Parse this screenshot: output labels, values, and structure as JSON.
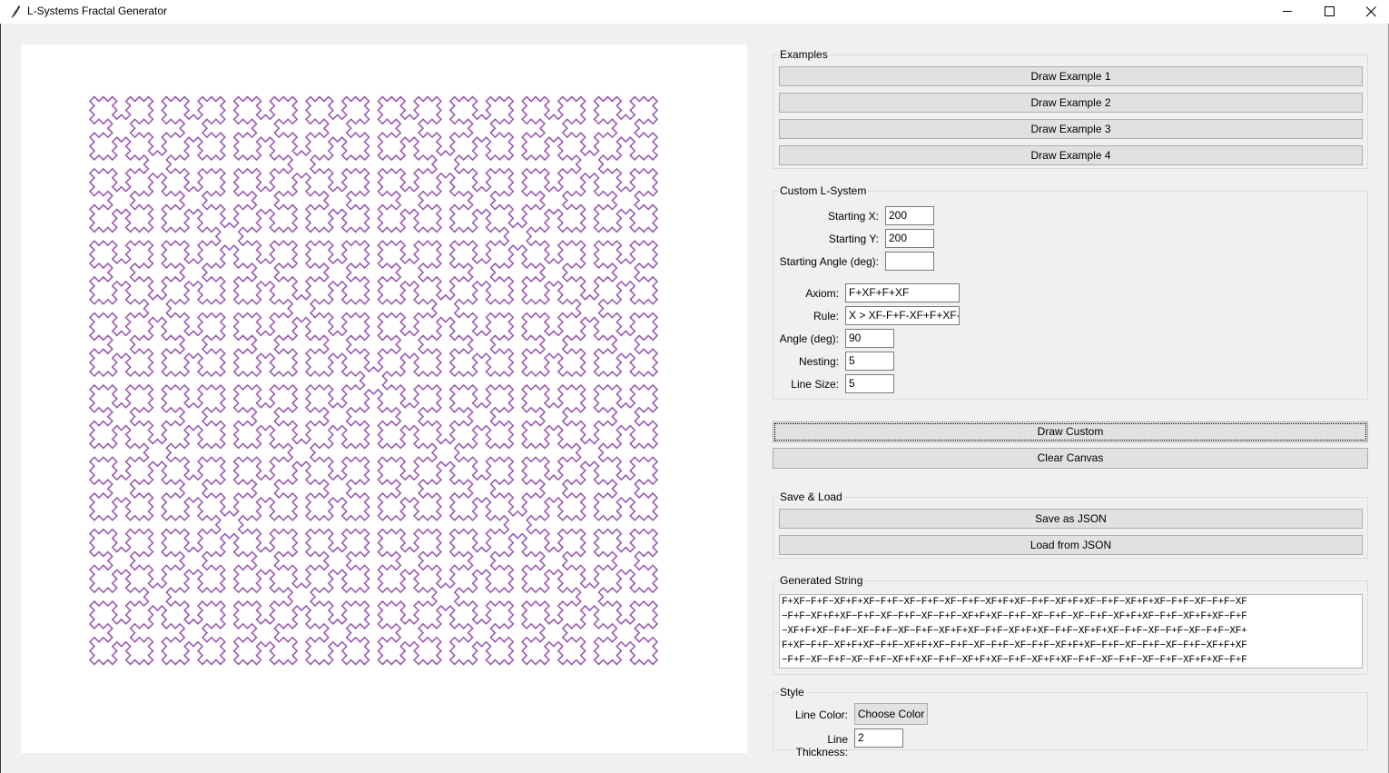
{
  "window": {
    "title": "L-Systems Fractal Generator",
    "controls": {
      "minimize": "minimize-icon",
      "maximize": "maximize-icon",
      "close": "close-icon"
    }
  },
  "canvas": {
    "background": "#ffffff",
    "line_color": "#9b59b6",
    "fractal": {
      "axiom": "F+XF+F+XF",
      "rule": "X > XF-F+F-XF+F+XF-F+F-X",
      "angle_deg": 90,
      "nesting": 5,
      "line_size": 5,
      "line_thickness": 2
    }
  },
  "examples": {
    "legend": "Examples",
    "buttons": [
      "Draw Example 1",
      "Draw Example 2",
      "Draw Example 3",
      "Draw Example 4"
    ]
  },
  "custom": {
    "legend": "Custom L-System",
    "start_x": {
      "label": "Starting X:",
      "value": "200"
    },
    "start_y": {
      "label": "Starting Y:",
      "value": "200"
    },
    "start_angle": {
      "label": "Starting Angle (deg):",
      "value": ""
    },
    "axiom": {
      "label": "Axiom:",
      "value": "F+XF+F+XF"
    },
    "rule": {
      "label": "Rule:",
      "value": "X > XF-F+F-XF+F+XF-F"
    },
    "angle": {
      "label": "Angle (deg):",
      "value": "90"
    },
    "nesting": {
      "label": "Nesting:",
      "value": "5"
    },
    "line_size": {
      "label": "Line Size:",
      "value": "5"
    }
  },
  "actions": {
    "draw_custom": "Draw Custom",
    "clear_canvas": "Clear Canvas"
  },
  "save_load": {
    "legend": "Save & Load",
    "save": "Save as JSON",
    "load": "Load from JSON"
  },
  "generated": {
    "legend": "Generated String",
    "lines": [
      "F+XF−F+F−XF+F+XF−F+F−XF−F+F−XF−F+F−XF+F+XF−F+F−XF+F+XF−F+F−XF+F+XF−F+F−XF−F+F−XF",
      "−F+F−XF+F+XF−F+F−XF−F+F−XF−F+F−XF+F+XF−F+F−XF−F+F−XF−F+F−XF+F+XF−F+F−XF+F+XF−F+F",
      "−XF+F+XF−F+F−XF−F+F−XF−F+F−XF+F+XF−F+F−XF+F+XF−F+F−XF+F+XF−F+F−XF−F+F−XF−F+F−XF+",
      "F+XF−F+F−XF+F+XF−F+F−XF+F+XF−F+F−XF−F+F−XF−F+F−XF+F+XF−F+F−XF−F+F−XF−F+F−XF+F+XF",
      "−F+F−XF−F+F−XF−F+F−XF+F+XF−F+F−XF+F+XF−F+F−XF+F+XF−F+F−XF−F+F−XF−F+F−XF+F+XF−F+F"
    ]
  },
  "style": {
    "legend": "Style",
    "line_color_label": "Line Color:",
    "choose_color": "Choose Color",
    "thickness_label": "Line Thickness:",
    "thickness_value": "2"
  }
}
